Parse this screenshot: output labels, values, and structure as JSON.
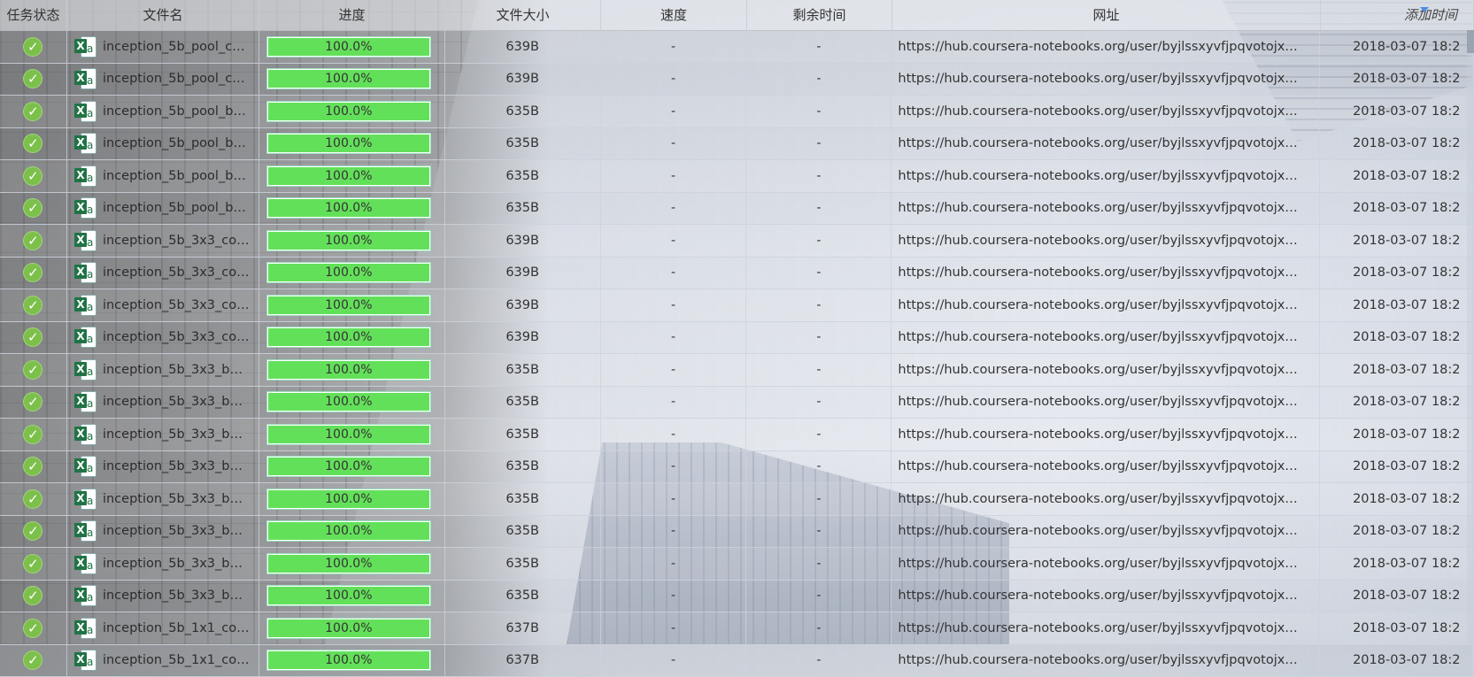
{
  "columns": {
    "status": "任务状态",
    "name": "文件名",
    "progress": "进度",
    "size": "文件大小",
    "speed": "速度",
    "remaining": "剩余时间",
    "url": "网址",
    "added": "添加时间"
  },
  "sort": {
    "column": "added",
    "direction": "desc",
    "indicator_color": "#4a8fe0"
  },
  "colors": {
    "progress_fill": "#63e05a",
    "status_ok": "#7cc04b",
    "excel_green": "#217346"
  },
  "rows": [
    {
      "status": "completed",
      "status_icon": "check-circle-icon",
      "file_icon": "excel-icon",
      "name": "inception_5b_pool_c…",
      "progress": 1.0,
      "progress_text": "100.0%",
      "size": "639B",
      "speed": "-",
      "remaining": "-",
      "url": "https://hub.coursera-notebooks.org/user/byjlssxyvfjpqvotojx…",
      "added": "2018-03-07 18:2"
    },
    {
      "status": "completed",
      "status_icon": "check-circle-icon",
      "file_icon": "excel-icon",
      "name": "inception_5b_pool_c…",
      "progress": 1.0,
      "progress_text": "100.0%",
      "size": "639B",
      "speed": "-",
      "remaining": "-",
      "url": "https://hub.coursera-notebooks.org/user/byjlssxyvfjpqvotojx…",
      "added": "2018-03-07 18:2"
    },
    {
      "status": "completed",
      "status_icon": "check-circle-icon",
      "file_icon": "excel-icon",
      "name": "inception_5b_pool_b…",
      "progress": 1.0,
      "progress_text": "100.0%",
      "size": "635B",
      "speed": "-",
      "remaining": "-",
      "url": "https://hub.coursera-notebooks.org/user/byjlssxyvfjpqvotojx…",
      "added": "2018-03-07 18:2"
    },
    {
      "status": "completed",
      "status_icon": "check-circle-icon",
      "file_icon": "excel-icon",
      "name": "inception_5b_pool_b…",
      "progress": 1.0,
      "progress_text": "100.0%",
      "size": "635B",
      "speed": "-",
      "remaining": "-",
      "url": "https://hub.coursera-notebooks.org/user/byjlssxyvfjpqvotojx…",
      "added": "2018-03-07 18:2"
    },
    {
      "status": "completed",
      "status_icon": "check-circle-icon",
      "file_icon": "excel-icon",
      "name": "inception_5b_pool_b…",
      "progress": 1.0,
      "progress_text": "100.0%",
      "size": "635B",
      "speed": "-",
      "remaining": "-",
      "url": "https://hub.coursera-notebooks.org/user/byjlssxyvfjpqvotojx…",
      "added": "2018-03-07 18:2"
    },
    {
      "status": "completed",
      "status_icon": "check-circle-icon",
      "file_icon": "excel-icon",
      "name": "inception_5b_pool_b…",
      "progress": 1.0,
      "progress_text": "100.0%",
      "size": "635B",
      "speed": "-",
      "remaining": "-",
      "url": "https://hub.coursera-notebooks.org/user/byjlssxyvfjpqvotojx…",
      "added": "2018-03-07 18:2"
    },
    {
      "status": "completed",
      "status_icon": "check-circle-icon",
      "file_icon": "excel-icon",
      "name": "inception_5b_3x3_co…",
      "progress": 1.0,
      "progress_text": "100.0%",
      "size": "639B",
      "speed": "-",
      "remaining": "-",
      "url": "https://hub.coursera-notebooks.org/user/byjlssxyvfjpqvotojx…",
      "added": "2018-03-07 18:2"
    },
    {
      "status": "completed",
      "status_icon": "check-circle-icon",
      "file_icon": "excel-icon",
      "name": "inception_5b_3x3_co…",
      "progress": 1.0,
      "progress_text": "100.0%",
      "size": "639B",
      "speed": "-",
      "remaining": "-",
      "url": "https://hub.coursera-notebooks.org/user/byjlssxyvfjpqvotojx…",
      "added": "2018-03-07 18:2"
    },
    {
      "status": "completed",
      "status_icon": "check-circle-icon",
      "file_icon": "excel-icon",
      "name": "inception_5b_3x3_co…",
      "progress": 1.0,
      "progress_text": "100.0%",
      "size": "639B",
      "speed": "-",
      "remaining": "-",
      "url": "https://hub.coursera-notebooks.org/user/byjlssxyvfjpqvotojx…",
      "added": "2018-03-07 18:2"
    },
    {
      "status": "completed",
      "status_icon": "check-circle-icon",
      "file_icon": "excel-icon",
      "name": "inception_5b_3x3_co…",
      "progress": 1.0,
      "progress_text": "100.0%",
      "size": "639B",
      "speed": "-",
      "remaining": "-",
      "url": "https://hub.coursera-notebooks.org/user/byjlssxyvfjpqvotojx…",
      "added": "2018-03-07 18:2"
    },
    {
      "status": "completed",
      "status_icon": "check-circle-icon",
      "file_icon": "excel-icon",
      "name": "inception_5b_3x3_b…",
      "progress": 1.0,
      "progress_text": "100.0%",
      "size": "635B",
      "speed": "-",
      "remaining": "-",
      "url": "https://hub.coursera-notebooks.org/user/byjlssxyvfjpqvotojx…",
      "added": "2018-03-07 18:2"
    },
    {
      "status": "completed",
      "status_icon": "check-circle-icon",
      "file_icon": "excel-icon",
      "name": "inception_5b_3x3_b…",
      "progress": 1.0,
      "progress_text": "100.0%",
      "size": "635B",
      "speed": "-",
      "remaining": "-",
      "url": "https://hub.coursera-notebooks.org/user/byjlssxyvfjpqvotojx…",
      "added": "2018-03-07 18:2"
    },
    {
      "status": "completed",
      "status_icon": "check-circle-icon",
      "file_icon": "excel-icon",
      "name": "inception_5b_3x3_b…",
      "progress": 1.0,
      "progress_text": "100.0%",
      "size": "635B",
      "speed": "-",
      "remaining": "-",
      "url": "https://hub.coursera-notebooks.org/user/byjlssxyvfjpqvotojx…",
      "added": "2018-03-07 18:2"
    },
    {
      "status": "completed",
      "status_icon": "check-circle-icon",
      "file_icon": "excel-icon",
      "name": "inception_5b_3x3_b…",
      "progress": 1.0,
      "progress_text": "100.0%",
      "size": "635B",
      "speed": "-",
      "remaining": "-",
      "url": "https://hub.coursera-notebooks.org/user/byjlssxyvfjpqvotojx…",
      "added": "2018-03-07 18:2"
    },
    {
      "status": "completed",
      "status_icon": "check-circle-icon",
      "file_icon": "excel-icon",
      "name": "inception_5b_3x3_b…",
      "progress": 1.0,
      "progress_text": "100.0%",
      "size": "635B",
      "speed": "-",
      "remaining": "-",
      "url": "https://hub.coursera-notebooks.org/user/byjlssxyvfjpqvotojx…",
      "added": "2018-03-07 18:2"
    },
    {
      "status": "completed",
      "status_icon": "check-circle-icon",
      "file_icon": "excel-icon",
      "name": "inception_5b_3x3_b…",
      "progress": 1.0,
      "progress_text": "100.0%",
      "size": "635B",
      "speed": "-",
      "remaining": "-",
      "url": "https://hub.coursera-notebooks.org/user/byjlssxyvfjpqvotojx…",
      "added": "2018-03-07 18:2"
    },
    {
      "status": "completed",
      "status_icon": "check-circle-icon",
      "file_icon": "excel-icon",
      "name": "inception_5b_3x3_b…",
      "progress": 1.0,
      "progress_text": "100.0%",
      "size": "635B",
      "speed": "-",
      "remaining": "-",
      "url": "https://hub.coursera-notebooks.org/user/byjlssxyvfjpqvotojx…",
      "added": "2018-03-07 18:2"
    },
    {
      "status": "completed",
      "status_icon": "check-circle-icon",
      "file_icon": "excel-icon",
      "name": "inception_5b_3x3_b…",
      "progress": 1.0,
      "progress_text": "100.0%",
      "size": "635B",
      "speed": "-",
      "remaining": "-",
      "url": "https://hub.coursera-notebooks.org/user/byjlssxyvfjpqvotojx…",
      "added": "2018-03-07 18:2"
    },
    {
      "status": "completed",
      "status_icon": "check-circle-icon",
      "file_icon": "excel-icon",
      "name": "inception_5b_1x1_co…",
      "progress": 1.0,
      "progress_text": "100.0%",
      "size": "637B",
      "speed": "-",
      "remaining": "-",
      "url": "https://hub.coursera-notebooks.org/user/byjlssxyvfjpqvotojx…",
      "added": "2018-03-07 18:2"
    },
    {
      "status": "completed",
      "status_icon": "check-circle-icon",
      "file_icon": "excel-icon",
      "name": "inception_5b_1x1_co…",
      "progress": 1.0,
      "progress_text": "100.0%",
      "size": "637B",
      "speed": "-",
      "remaining": "-",
      "url": "https://hub.coursera-notebooks.org/user/byjlssxyvfjpqvotojx…",
      "added": "2018-03-07 18:2"
    }
  ]
}
